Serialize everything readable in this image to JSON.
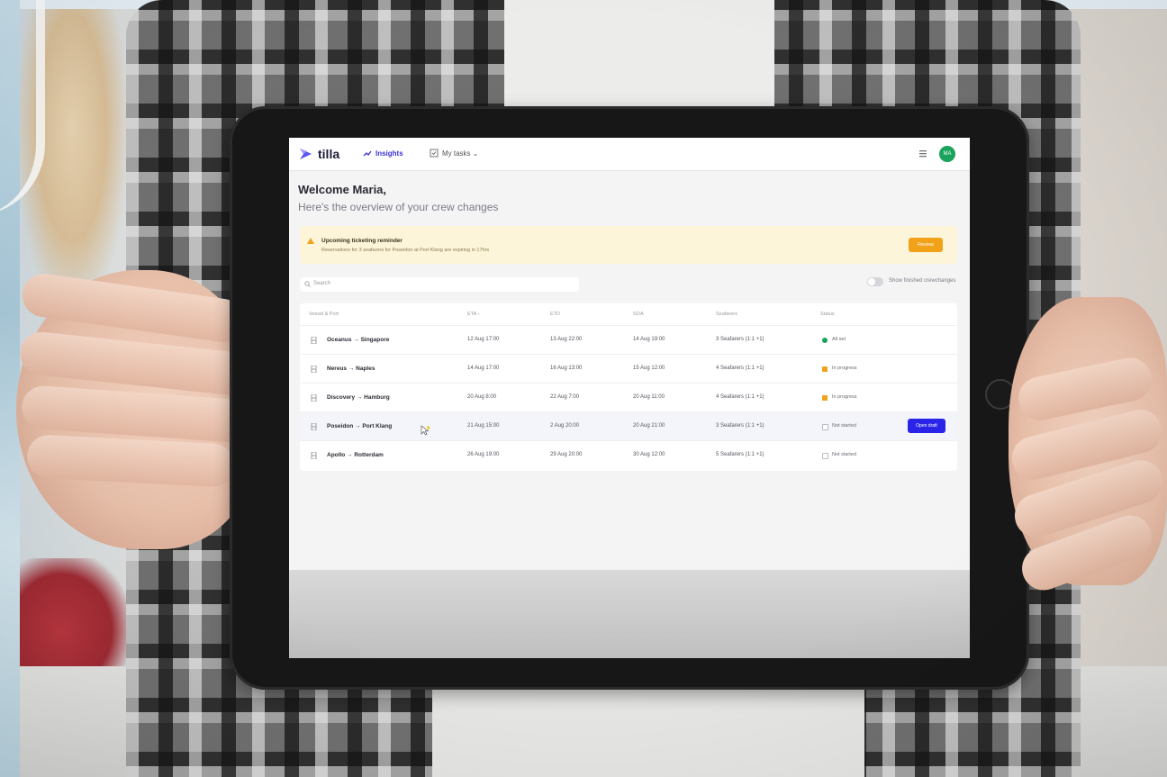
{
  "app": {
    "logo_text": "tilla",
    "nav": {
      "insights_label": "Insights",
      "mytasks_label": "My tasks ⌄"
    },
    "avatar_initials": "MA"
  },
  "header": {
    "welcome": "Welcome Maria,",
    "subtitle": "Here's the overview of your crew changes"
  },
  "reminder": {
    "title": "Upcoming ticketing reminder",
    "text": "Reservations for 3 seafarers for Poseidon at Port Klang are expiring in 17hrs",
    "button_label": "Review"
  },
  "search": {
    "placeholder": "Search"
  },
  "toggle": {
    "label": "Show finished crewchanges"
  },
  "table": {
    "headers": [
      "Vessel & Port",
      "ETA ↓",
      "ETD",
      "SOA",
      "Seafarers",
      "Status"
    ],
    "rows": [
      {
        "route": "Oceanus → Singapore",
        "eta": "12 Aug 17:00",
        "etd": "13 Aug 22:00",
        "soa": "14 Aug 19:00",
        "seafarers": "3 Seafarers (1:1 +1)",
        "status": "All set",
        "status_color": "#1aa35a"
      },
      {
        "route": "Nereus → Naples",
        "eta": "14 Aug 17:00",
        "etd": "16 Aug 13:00",
        "soa": "15 Aug 12:00",
        "seafarers": "4 Seafarers (1:1 +1)",
        "status": "In progress",
        "status_color": "#f2a219"
      },
      {
        "route": "Discovery → Hamburg",
        "eta": "20 Aug 8:00",
        "etd": "22 Aug 7:00",
        "soa": "20 Aug 11:00",
        "seafarers": "4 Seafarers (1:1 +1)",
        "status": "In progress",
        "status_color": "#f2a219"
      },
      {
        "route": "Poseidon → Port Klang",
        "eta": "21 Aug 15:00",
        "etd": "2 Aug 20:00",
        "soa": "20 Aug 21:00",
        "seafarers": "3 Seafarers (1:1 +1)",
        "status": "Not started",
        "status_color": "#b9b9c2",
        "action_label": "Open draft"
      },
      {
        "route": "Apollo → Rotterdam",
        "eta": "26 Aug 19:00",
        "etd": "29 Aug 20:00",
        "soa": "30 Aug 12:00",
        "seafarers": "5 Seafarers (1:1 +1)",
        "status": "Not started",
        "status_color": "#b9b9c2"
      }
    ]
  },
  "colors": {
    "accent": "#3a32d6",
    "button_primary": "#2a24e8",
    "warning": "#f2a219",
    "success": "#1aa35a"
  }
}
